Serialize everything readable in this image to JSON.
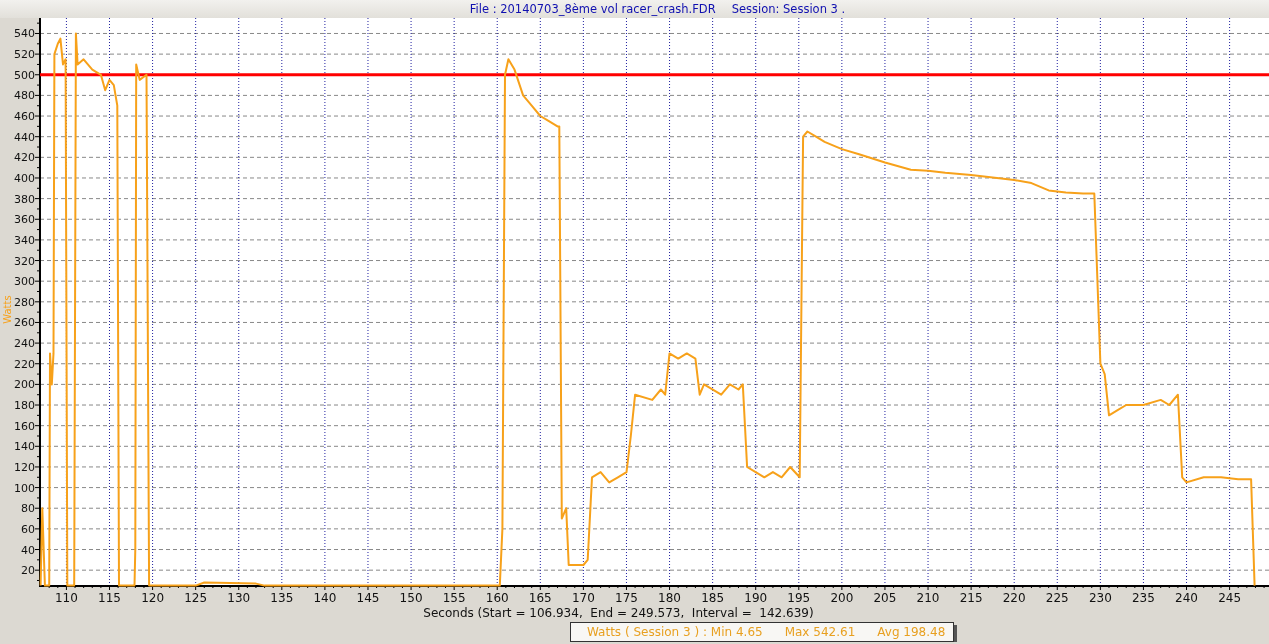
{
  "title_bar": {
    "file_label": "File : 20140703_8ème vol racer_crash.FDR",
    "session_label": "Session: Session 3 ."
  },
  "chart_data": {
    "type": "line",
    "xlabel": "Seconds (Start = 106.934,  End = 249.573,  Interval =  142.639)",
    "ylabel": "Watts",
    "x": [
      107.0,
      107.2,
      107.5,
      108.0,
      108.1,
      108.3,
      108.5,
      108.6,
      109.0,
      109.3,
      109.6,
      109.9,
      110.1,
      110.9,
      111.1,
      111.3,
      112,
      113,
      114,
      114.5,
      115,
      115.5,
      115.9,
      116.1,
      117.9,
      118.0,
      118.1,
      118.5,
      119.3,
      119.6,
      125,
      126,
      132,
      133,
      160.3,
      160.6,
      160.9,
      161.3,
      162,
      163,
      164,
      165,
      166,
      167,
      167.2,
      167.5,
      168,
      168.3,
      170,
      170.5,
      171,
      172,
      173,
      174,
      175,
      175.5,
      176,
      178,
      179,
      179.5,
      180,
      181,
      182,
      183,
      183.5,
      184,
      186,
      187,
      188,
      188.5,
      189,
      190,
      191,
      192,
      193,
      194,
      195.1,
      195.5,
      196,
      197,
      198,
      200,
      202,
      205,
      208,
      210,
      212,
      215,
      218,
      220,
      222,
      224,
      226,
      228,
      229.3,
      230,
      230.5,
      231,
      232,
      233,
      235,
      237,
      238,
      239,
      239.5,
      240,
      242,
      244,
      246,
      247.5,
      247.9
    ],
    "series": [
      {
        "name": "Watts ( Session 3 )",
        "color": "#f7a11a",
        "values": [
          5,
          80,
          5,
          5,
          230,
          200,
          230,
          520,
          530,
          535,
          510,
          515,
          5,
          5,
          540,
          510,
          515,
          505,
          500,
          485,
          495,
          490,
          470,
          5,
          5,
          40,
          510,
          495,
          500,
          5,
          5,
          8,
          7,
          5,
          5,
          60,
          500,
          515,
          505,
          480,
          470,
          460,
          455,
          450,
          450,
          70,
          80,
          25,
          25,
          30,
          110,
          115,
          105,
          110,
          115,
          150,
          190,
          185,
          195,
          190,
          230,
          225,
          230,
          225,
          190,
          200,
          190,
          200,
          195,
          200,
          120,
          115,
          110,
          115,
          110,
          120,
          110,
          440,
          445,
          440,
          435,
          428,
          423,
          415,
          408,
          407,
          405,
          403,
          400,
          398,
          395,
          388,
          386,
          385,
          385,
          220,
          210,
          170,
          175,
          180,
          180,
          185,
          180,
          190,
          110,
          105,
          110,
          110,
          108,
          108,
          5
        ]
      }
    ],
    "xlim": [
      106.934,
      249.573
    ],
    "ylim": [
      4.65,
      555
    ],
    "xticks": [
      110,
      115,
      120,
      125,
      130,
      135,
      140,
      145,
      150,
      155,
      160,
      165,
      170,
      175,
      180,
      185,
      190,
      195,
      200,
      205,
      210,
      215,
      220,
      225,
      230,
      235,
      240,
      245
    ],
    "yticks": [
      20,
      40,
      60,
      80,
      100,
      120,
      140,
      160,
      180,
      200,
      220,
      240,
      260,
      280,
      300,
      320,
      340,
      360,
      380,
      400,
      420,
      440,
      460,
      480,
      500,
      520,
      540
    ],
    "grid": true,
    "ref_lines": [
      {
        "axis": "y",
        "value": 500,
        "color": "#ff0000"
      }
    ]
  },
  "legend": {
    "separator": ":",
    "min": "Min 4.65",
    "max": "Max 542.61",
    "avg": "Avg 198.48"
  }
}
